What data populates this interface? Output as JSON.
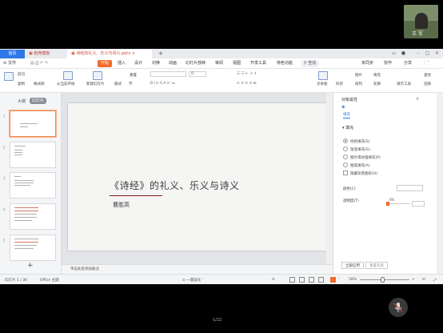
{
  "video_call": {
    "participant_name": "王 军",
    "page_indicator": "1/22"
  },
  "app": {
    "tabs": [
      {
        "label": "首页"
      },
      {
        "label": "稻壳模板"
      },
      {
        "label": "诗经的礼义、乐义与诗义.pptx"
      }
    ],
    "new_tab_label": "+",
    "menu": [
      "文件",
      "开始",
      "插入",
      "设计",
      "切换",
      "动画",
      "幻灯片放映",
      "审阅",
      "视图",
      "开发工具",
      "特色功能"
    ],
    "search_label": "查找",
    "right_menu": [
      "未同步",
      "协作",
      "分享"
    ],
    "ribbon": {
      "cut": "剪切",
      "copy": "复制",
      "format_painter": "格式刷",
      "from_start": "从当前开始",
      "new_slide": "新建幻灯片",
      "layout": "版式",
      "section": "节",
      "reset": "重置",
      "font_size": "0",
      "textbox": "文本框",
      "shape": "形状",
      "picture": "图片",
      "arrange": "排列",
      "fill": "填充",
      "outline": "轮廓",
      "find": "查找",
      "replace": "替换",
      "select": "选择",
      "presentation_tools": "演示工具"
    },
    "left_panel": {
      "tab_outline": "大纲",
      "tab_slides": "幻灯片",
      "slide_numbers": [
        "1",
        "2",
        "3",
        "4",
        "5"
      ],
      "add_slide": "+"
    },
    "slide": {
      "title": "《诗经》的礼义、乐义与诗义",
      "author": "曹胜高"
    },
    "notes_placeholder": "单击此处添加备注",
    "right_panel": {
      "title": "对象属性",
      "tab_fill": "填充",
      "section": "填充",
      "options": [
        {
          "label": "纯色填充(S)",
          "type": "radio",
          "checked": true
        },
        {
          "label": "渐变填充(G)",
          "type": "radio",
          "checked": false
        },
        {
          "label": "图片或纹理填充(P)",
          "type": "radio",
          "checked": false
        },
        {
          "label": "图案填充(A)",
          "type": "radio",
          "checked": false
        },
        {
          "label": "隐藏背景图形(H)",
          "type": "checkbox",
          "checked": false
        }
      ],
      "color_label": "颜色(C)",
      "opacity_label": "透明度(T)",
      "opacity_value": "0%",
      "apply_all": "全部应用",
      "reset_bg": "重置背景"
    },
    "status": {
      "slide_counter": "幻灯片 1 / 36",
      "theme": "Office 主题",
      "beautify": "一键美化",
      "zoom": "58%",
      "zoom_fraction": 0.45
    },
    "colors": {
      "accent": "#2f78e7",
      "start_tab": "#f06c2c",
      "title_rule": "#7a1f1f"
    }
  }
}
